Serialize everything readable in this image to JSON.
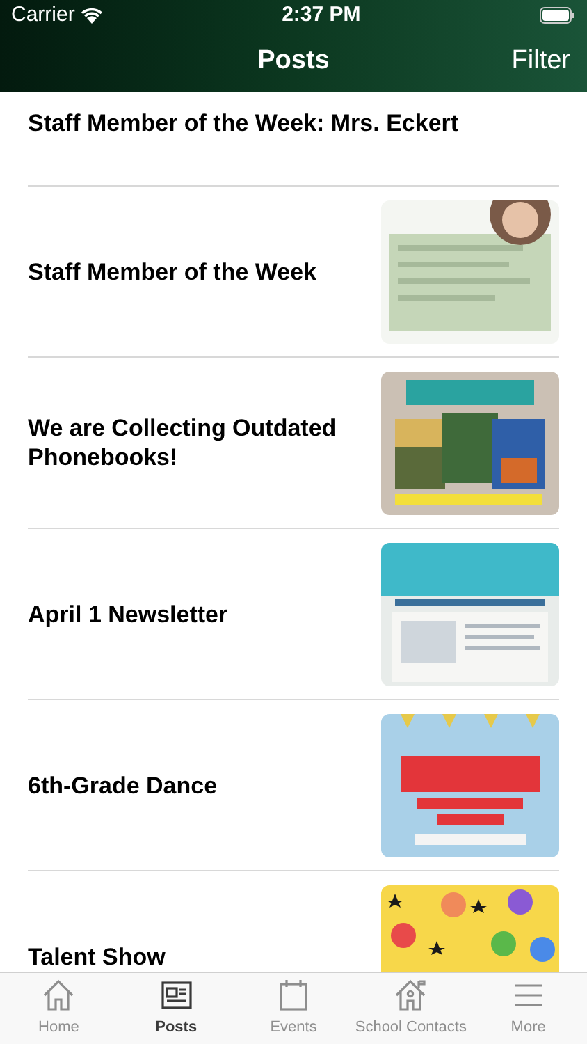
{
  "status_bar": {
    "carrier": "Carrier",
    "time": "2:37 PM"
  },
  "nav_bar": {
    "title": "Posts",
    "action": "Filter"
  },
  "posts": [
    {
      "title": "Staff Member of the Week: Mrs. Eckert"
    },
    {
      "title": "Staff Member of the Week"
    },
    {
      "title": "We are Collecting Outdated Phonebooks!"
    },
    {
      "title": "April 1 Newsletter"
    },
    {
      "title": "6th-Grade Dance"
    },
    {
      "title": "Talent Show"
    }
  ],
  "tab_bar": [
    {
      "label": "Home",
      "kind": "home",
      "selected": false
    },
    {
      "label": "Posts",
      "kind": "posts",
      "selected": true
    },
    {
      "label": "Events",
      "kind": "events",
      "selected": false
    },
    {
      "label": "School Contacts",
      "kind": "contacts",
      "selected": false
    },
    {
      "label": "More",
      "kind": "more",
      "selected": false
    }
  ]
}
